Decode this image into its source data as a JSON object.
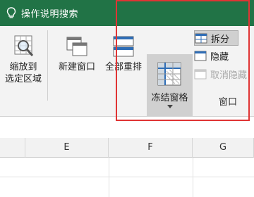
{
  "title_bar": {
    "tell_me": "操作说明搜索",
    "bulb_icon": "lightbulb-icon"
  },
  "ribbon": {
    "zoom_to_selection": [
      "缩放到",
      "选定区域"
    ],
    "new_window": "新建窗口",
    "arrange_all": "全部重排",
    "freeze_panes": "冻结窗格",
    "split": "拆分",
    "hide": "隐藏",
    "unhide": "取消隐藏",
    "group_window": "窗口"
  },
  "grid": {
    "columns": [
      "E",
      "F",
      "G"
    ]
  },
  "colors": {
    "accent": "#217346",
    "highlight": "#e03434"
  }
}
